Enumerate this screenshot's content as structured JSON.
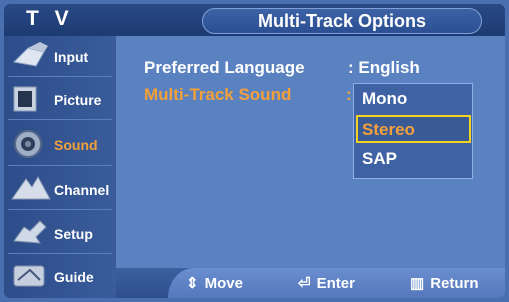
{
  "header": {
    "tv_label": "T V",
    "title": "Multi-Track Options"
  },
  "sidebar": {
    "items": [
      {
        "label": "Input",
        "icon": "input-icon"
      },
      {
        "label": "Picture",
        "icon": "picture-icon"
      },
      {
        "label": "Sound",
        "icon": "sound-icon",
        "active": true
      },
      {
        "label": "Channel",
        "icon": "channel-icon"
      },
      {
        "label": "Setup",
        "icon": "setup-icon"
      },
      {
        "label": "Guide",
        "icon": "guide-icon"
      }
    ]
  },
  "main": {
    "preferred_language_label": "Preferred Language",
    "preferred_language_value": ": English",
    "multi_track_label": "Multi-Track Sound",
    "multi_track_colon": ":",
    "options": [
      "Mono",
      "Stereo",
      "SAP"
    ],
    "selected_option": "Stereo"
  },
  "footer": {
    "move": "Move",
    "enter": "Enter",
    "return": "Return"
  },
  "colors": {
    "accent_orange": "#f3a03a",
    "highlight_yellow": "#f2d21c",
    "background_blue": "#5b82c0"
  }
}
